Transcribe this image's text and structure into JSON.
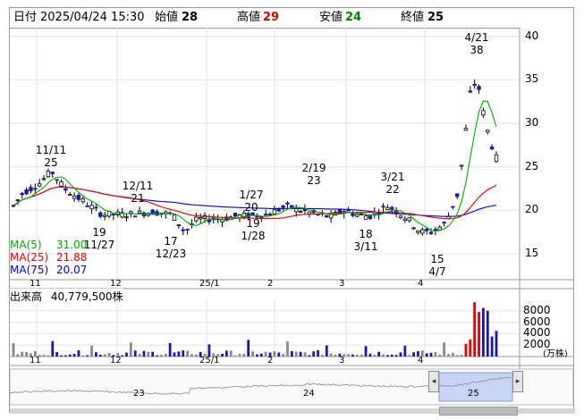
{
  "header": {
    "date_label": "日付",
    "date_value": "2025/04/24 15:30",
    "open_label": "始値",
    "open_value": "28",
    "high_label": "高値",
    "high_value": "29",
    "low_label": "安値",
    "low_value": "24",
    "close_label": "終値",
    "close_value": "25"
  },
  "colors": {
    "high": "#d00000",
    "low": "#008000",
    "ma5": "#00aa00",
    "ma25": "#e00000",
    "ma75": "#0000e0",
    "candle_down": "#1a1aa8",
    "volume_up": "#e00000",
    "volume_down": "#1a1aa8"
  },
  "price_axis_ticks": [
    "40",
    "35",
    "30",
    "25",
    "20",
    "15"
  ],
  "month_labels": [
    "11",
    "12",
    "25/1",
    "2",
    "3",
    "4"
  ],
  "annotations": [
    {
      "id": "ann-1111",
      "date": "11/11",
      "value": "25"
    },
    {
      "id": "ann-1127",
      "date": "11/27",
      "value": "19"
    },
    {
      "id": "ann-1211",
      "date": "12/11",
      "value": "21"
    },
    {
      "id": "ann-1223",
      "date": "12/23",
      "value": "17"
    },
    {
      "id": "ann-0127",
      "date": "1/27",
      "value": "20"
    },
    {
      "id": "ann-0128",
      "date": "1/28",
      "value": "19"
    },
    {
      "id": "ann-0219",
      "date": "2/19",
      "value": "23"
    },
    {
      "id": "ann-0311",
      "date": "3/11",
      "value": "18"
    },
    {
      "id": "ann-0321",
      "date": "3/21",
      "value": "22"
    },
    {
      "id": "ann-0407",
      "date": "4/7",
      "value": "15"
    },
    {
      "id": "ann-0421",
      "date": "4/21",
      "value": "38"
    }
  ],
  "ma": [
    {
      "label": "MA(5)",
      "value": "31.00"
    },
    {
      "label": "MA(25)",
      "value": "21.88"
    },
    {
      "label": "MA(75)",
      "value": "20.07"
    }
  ],
  "volume": {
    "label": "出来高",
    "value": "40,779,500株",
    "ticks": [
      "8000",
      "6000",
      "4000",
      "2000"
    ],
    "unit": "(万株)"
  },
  "navigator": {
    "labels": [
      "23",
      "24",
      "25"
    ]
  },
  "chart_data": [
    {
      "type": "candlestick",
      "xlabel": "",
      "ylabel": "",
      "ylim": [
        12,
        41
      ],
      "x_ticks": [
        "11",
        "12",
        "25/1",
        "2",
        "3",
        "4"
      ],
      "y_ticks": [
        15,
        20,
        25,
        30,
        35,
        40
      ],
      "grid": true,
      "ohlc_approx": [
        {
          "date": "11/11",
          "high": 25
        },
        {
          "date": "11/27",
          "low": 19
        },
        {
          "date": "12/11",
          "high": 21
        },
        {
          "date": "12/23",
          "low": 17
        },
        {
          "date": "1/27",
          "high": 20
        },
        {
          "date": "1/28",
          "low": 19
        },
        {
          "date": "2/19",
          "high": 23
        },
        {
          "date": "3/11",
          "low": 18
        },
        {
          "date": "3/21",
          "high": 22
        },
        {
          "date": "4/7",
          "low": 15
        },
        {
          "date": "4/21",
          "high": 38
        },
        {
          "date": "2025/04/24",
          "open": 28,
          "high": 29,
          "low": 24,
          "close": 25
        }
      ],
      "series": [
        {
          "name": "MA(5)",
          "last": 31.0
        },
        {
          "name": "MA(25)",
          "last": 21.88
        },
        {
          "name": "MA(75)",
          "last": 20.07
        }
      ]
    },
    {
      "type": "bar",
      "title": "出来高",
      "ylabel": "(万株)",
      "ylim": [
        0,
        10000
      ],
      "y_ticks": [
        2000,
        4000,
        6000,
        8000
      ],
      "last_value": "40,779,500株",
      "peak_values_approx": [
        9500,
        7800,
        8500,
        8000
      ]
    }
  ]
}
